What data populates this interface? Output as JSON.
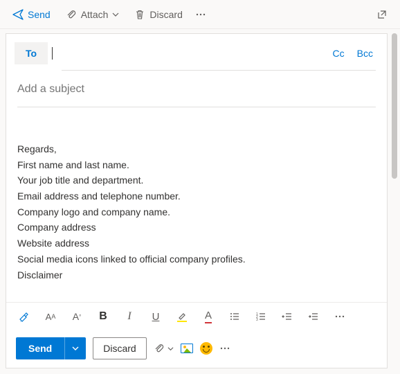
{
  "toolbar": {
    "send": "Send",
    "attach": "Attach",
    "discard": "Discard"
  },
  "compose": {
    "to_label": "To",
    "cc": "Cc",
    "bcc": "Bcc",
    "subject_placeholder": "Add a subject"
  },
  "body_lines": [
    "Regards,",
    "First name and last name.",
    "Your job title and department.",
    "Email address and telephone number.",
    "Company logo and company name.",
    "Company address",
    "Website address",
    "Social media icons linked to official company profiles.",
    "Disclaimer"
  ],
  "format": {
    "bold": "B",
    "italic": "I",
    "underline": "U",
    "fontcolor": "A"
  },
  "bottom": {
    "send": "Send",
    "discard": "Discard"
  }
}
